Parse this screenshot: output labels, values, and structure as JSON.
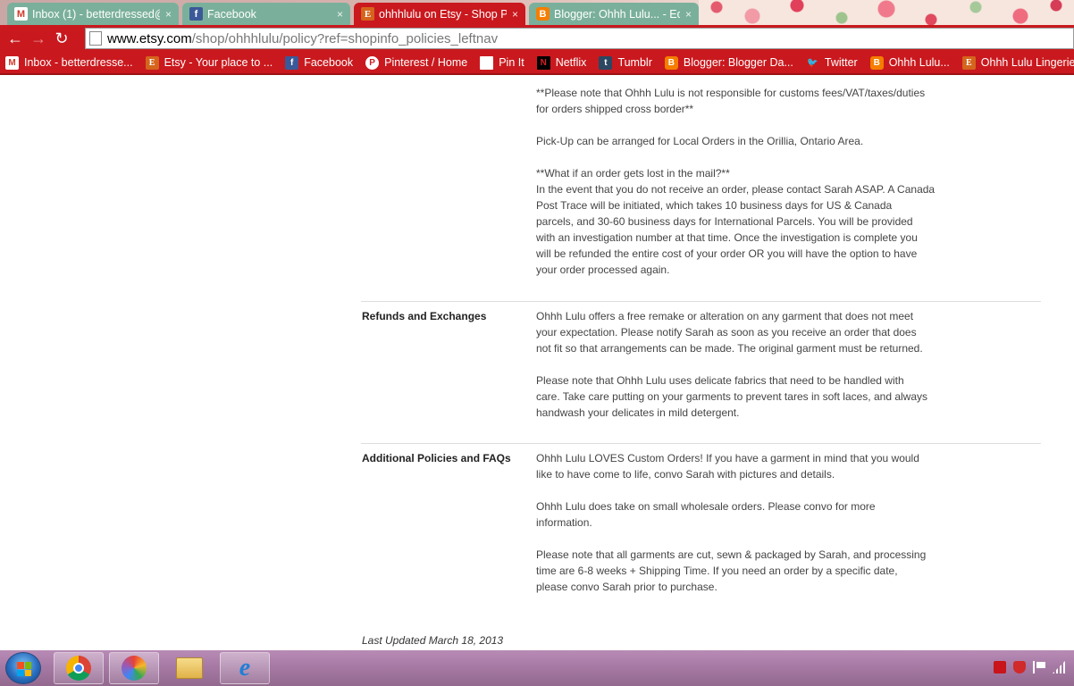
{
  "browser": {
    "tabs": [
      {
        "title": "Inbox (1) - betterdressed@",
        "favicon": "gmail-icon",
        "active": false
      },
      {
        "title": "Facebook",
        "favicon": "facebook-icon",
        "active": false
      },
      {
        "title": "ohhhlulu on Etsy - Shop P",
        "favicon": "etsy-icon",
        "active": true
      },
      {
        "title": "Blogger: Ohhh Lulu... - Ed",
        "favicon": "blogger-icon",
        "active": false
      }
    ],
    "close_glyph": "×",
    "address": {
      "host": "www.etsy.com",
      "path": "/shop/ohhhlulu/policy?ref=shopinfo_policies_leftnav"
    },
    "bookmarks": [
      {
        "label": "Inbox - betterdresse...",
        "icon": "gmail-icon",
        "glyph": "M"
      },
      {
        "label": "Etsy - Your place to ...",
        "icon": "etsy-icon",
        "glyph": "E"
      },
      {
        "label": "Facebook",
        "icon": "facebook-icon",
        "glyph": "f"
      },
      {
        "label": "Pinterest / Home",
        "icon": "pinterest-icon",
        "glyph": "P"
      },
      {
        "label": "Pin It",
        "icon": "page-icon",
        "glyph": ""
      },
      {
        "label": "Netflix",
        "icon": "netflix-icon",
        "glyph": "N"
      },
      {
        "label": "Tumblr",
        "icon": "tumblr-icon",
        "glyph": "t"
      },
      {
        "label": "Blogger: Blogger Da...",
        "icon": "blogger-icon",
        "glyph": "B"
      },
      {
        "label": "Twitter",
        "icon": "twitter-icon",
        "glyph": "🐦"
      },
      {
        "label": "Ohhh Lulu...",
        "icon": "blogger-icon",
        "glyph": "B"
      },
      {
        "label": "Ohhh Lulu Lingerie ...",
        "icon": "etsy-icon",
        "glyph": "E"
      }
    ]
  },
  "policy": {
    "shipping_lines": [
      "**Please note that Ohhh Lulu is not responsible for customs fees/VAT/taxes/duties",
      "for orders shipped cross border**",
      "",
      "Pick-Up can be arranged for Local Orders in the Orillia, Ontario Area.",
      "",
      "**What if an order gets lost in the mail?**",
      "In the event that you do not receive an order, please contact Sarah ASAP. A Canada",
      "Post Trace will be initiated, which takes 10 business days for US & Canada",
      "parcels, and 30-60 business days for International Parcels. You will be provided",
      "with an investigation number at that time. Once the investigation is complete you",
      "will be refunded the entire cost of your order OR you will have the option to have",
      "your order processed again."
    ],
    "refunds": {
      "label": "Refunds and Exchanges",
      "lines": [
        "Ohhh Lulu offers a free remake or alteration on any garment that does not meet",
        "your expectation. Please notify Sarah as soon as you receive an order that does",
        "not fit so that arrangements can be made. The original garment must be returned.",
        "",
        "Please note that Ohhh Lulu uses delicate fabrics that need to be handled with",
        "care. Take care putting on your garments to prevent tares in soft laces, and always",
        "handwash your delicates in mild detergent."
      ]
    },
    "additional": {
      "label": "Additional Policies and FAQs",
      "lines": [
        "Ohhh Lulu LOVES Custom Orders! If you have a garment in mind that you would",
        "like to have come to life, convo Sarah with pictures and details.",
        "",
        "Ohhh Lulu does take on small wholesale orders. Please convo for more",
        "information.",
        "",
        "Please note that all garments are cut, sewn & packaged by Sarah, and processing",
        "time are 6-8 weeks + Shipping Time. If you need an order by a specific date,",
        "please convo Sarah prior to purchase."
      ]
    },
    "last_updated": "Last Updated March 18, 2013"
  },
  "taskbar": {
    "items": [
      "chrome-icon",
      "picasa-icon",
      "file-explorer-icon",
      "internet-explorer-icon"
    ],
    "tray": [
      "acrobat-icon",
      "shield-icon",
      "action-center-flag-icon",
      "network-icon"
    ]
  }
}
